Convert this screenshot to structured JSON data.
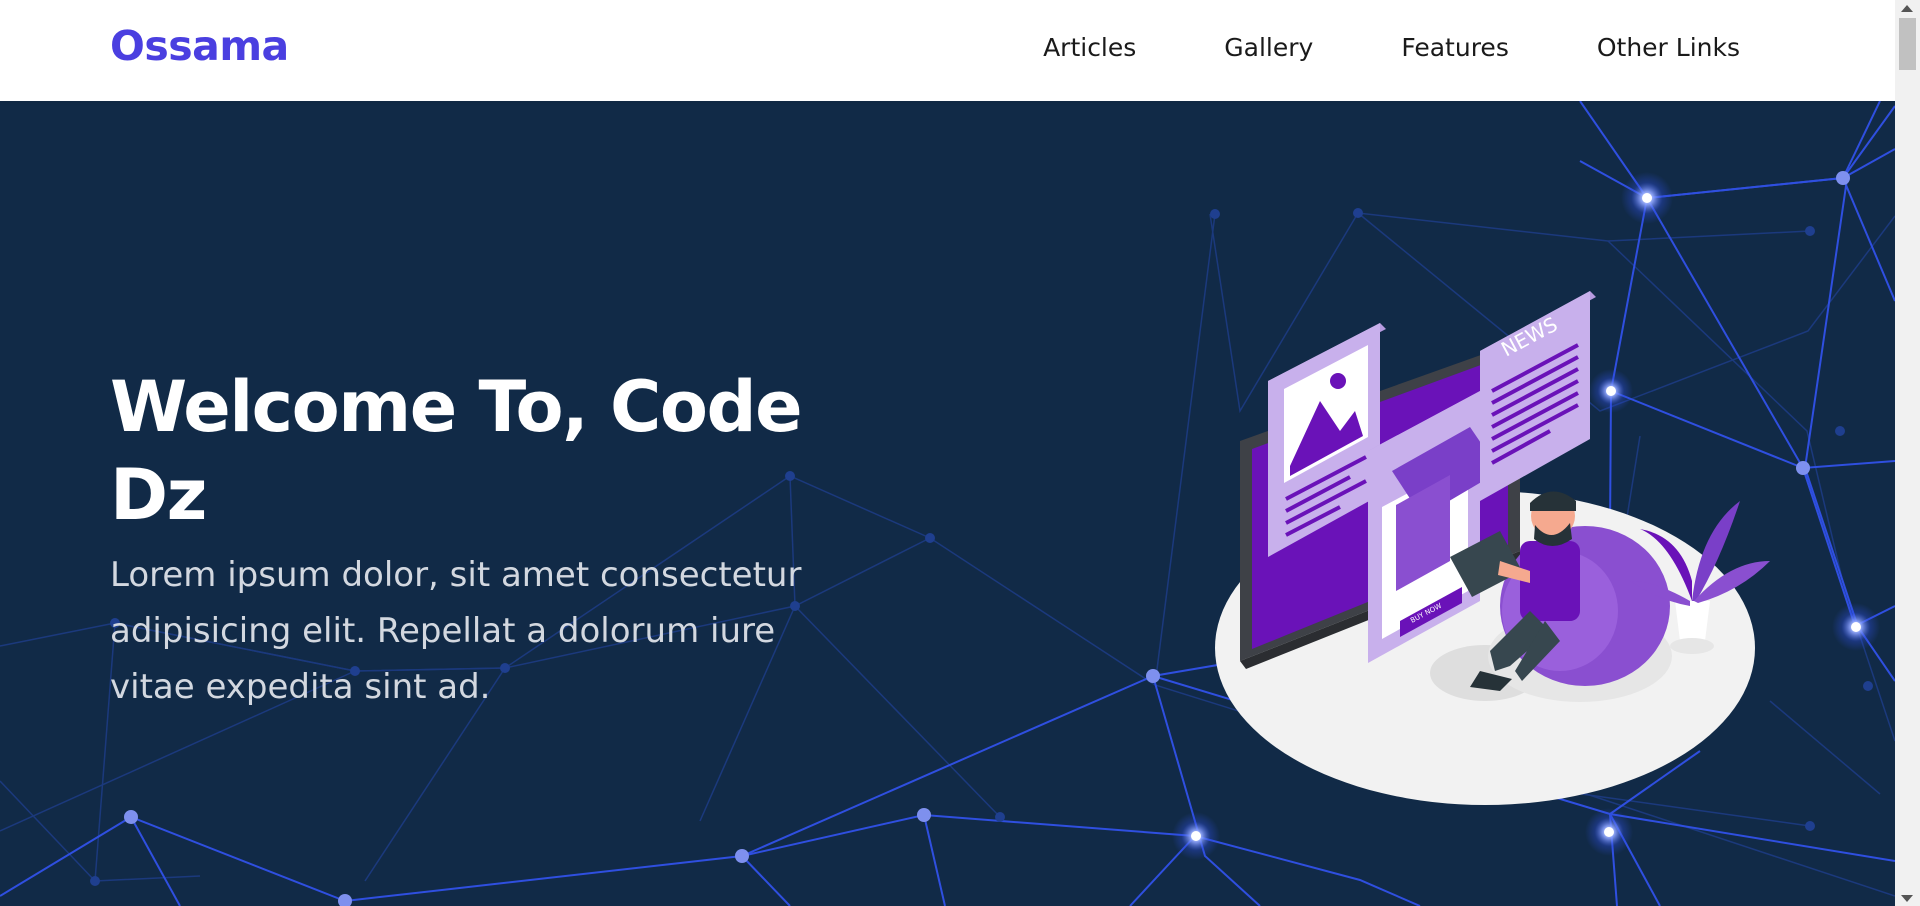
{
  "header": {
    "logo": "Ossama",
    "nav": [
      "Articles",
      "Gallery",
      "Features",
      "Other Links"
    ]
  },
  "hero": {
    "title": "Welcome To, Code Dz",
    "description": "Lorem ipsum dolor, sit amet consectetur adipisicing elit. Repellat a dolorum iure vitae expedita sint ad."
  },
  "illustration": {
    "news_label": "NEWS",
    "buy_label": "BUY NOW"
  },
  "colors": {
    "brand": "#4a3fe0",
    "hero_bg": "#112a47",
    "network_line": "#2f4fe0",
    "accent_purple": "#6a12b8"
  },
  "icons": [
    "network-background",
    "hero-illustration"
  ]
}
